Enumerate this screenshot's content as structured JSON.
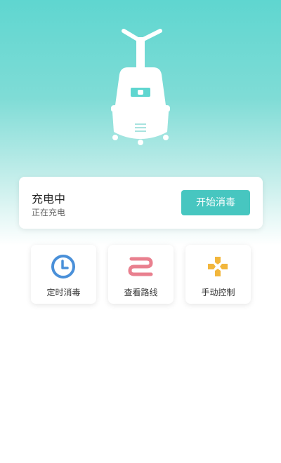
{
  "status": {
    "title": "充电中",
    "subtitle": "正在充电",
    "action_label": "开始消毒"
  },
  "functions": [
    {
      "label": "定时消毒",
      "icon": "clock-icon",
      "color": "#4a90d9"
    },
    {
      "label": "查看路线",
      "icon": "route-icon",
      "color": "#e9808f"
    },
    {
      "label": "手动控制",
      "icon": "dpad-icon",
      "color": "#f2b63c"
    }
  ],
  "colors": {
    "accent": "#47c6c0",
    "hero": "#5fd6d0"
  }
}
